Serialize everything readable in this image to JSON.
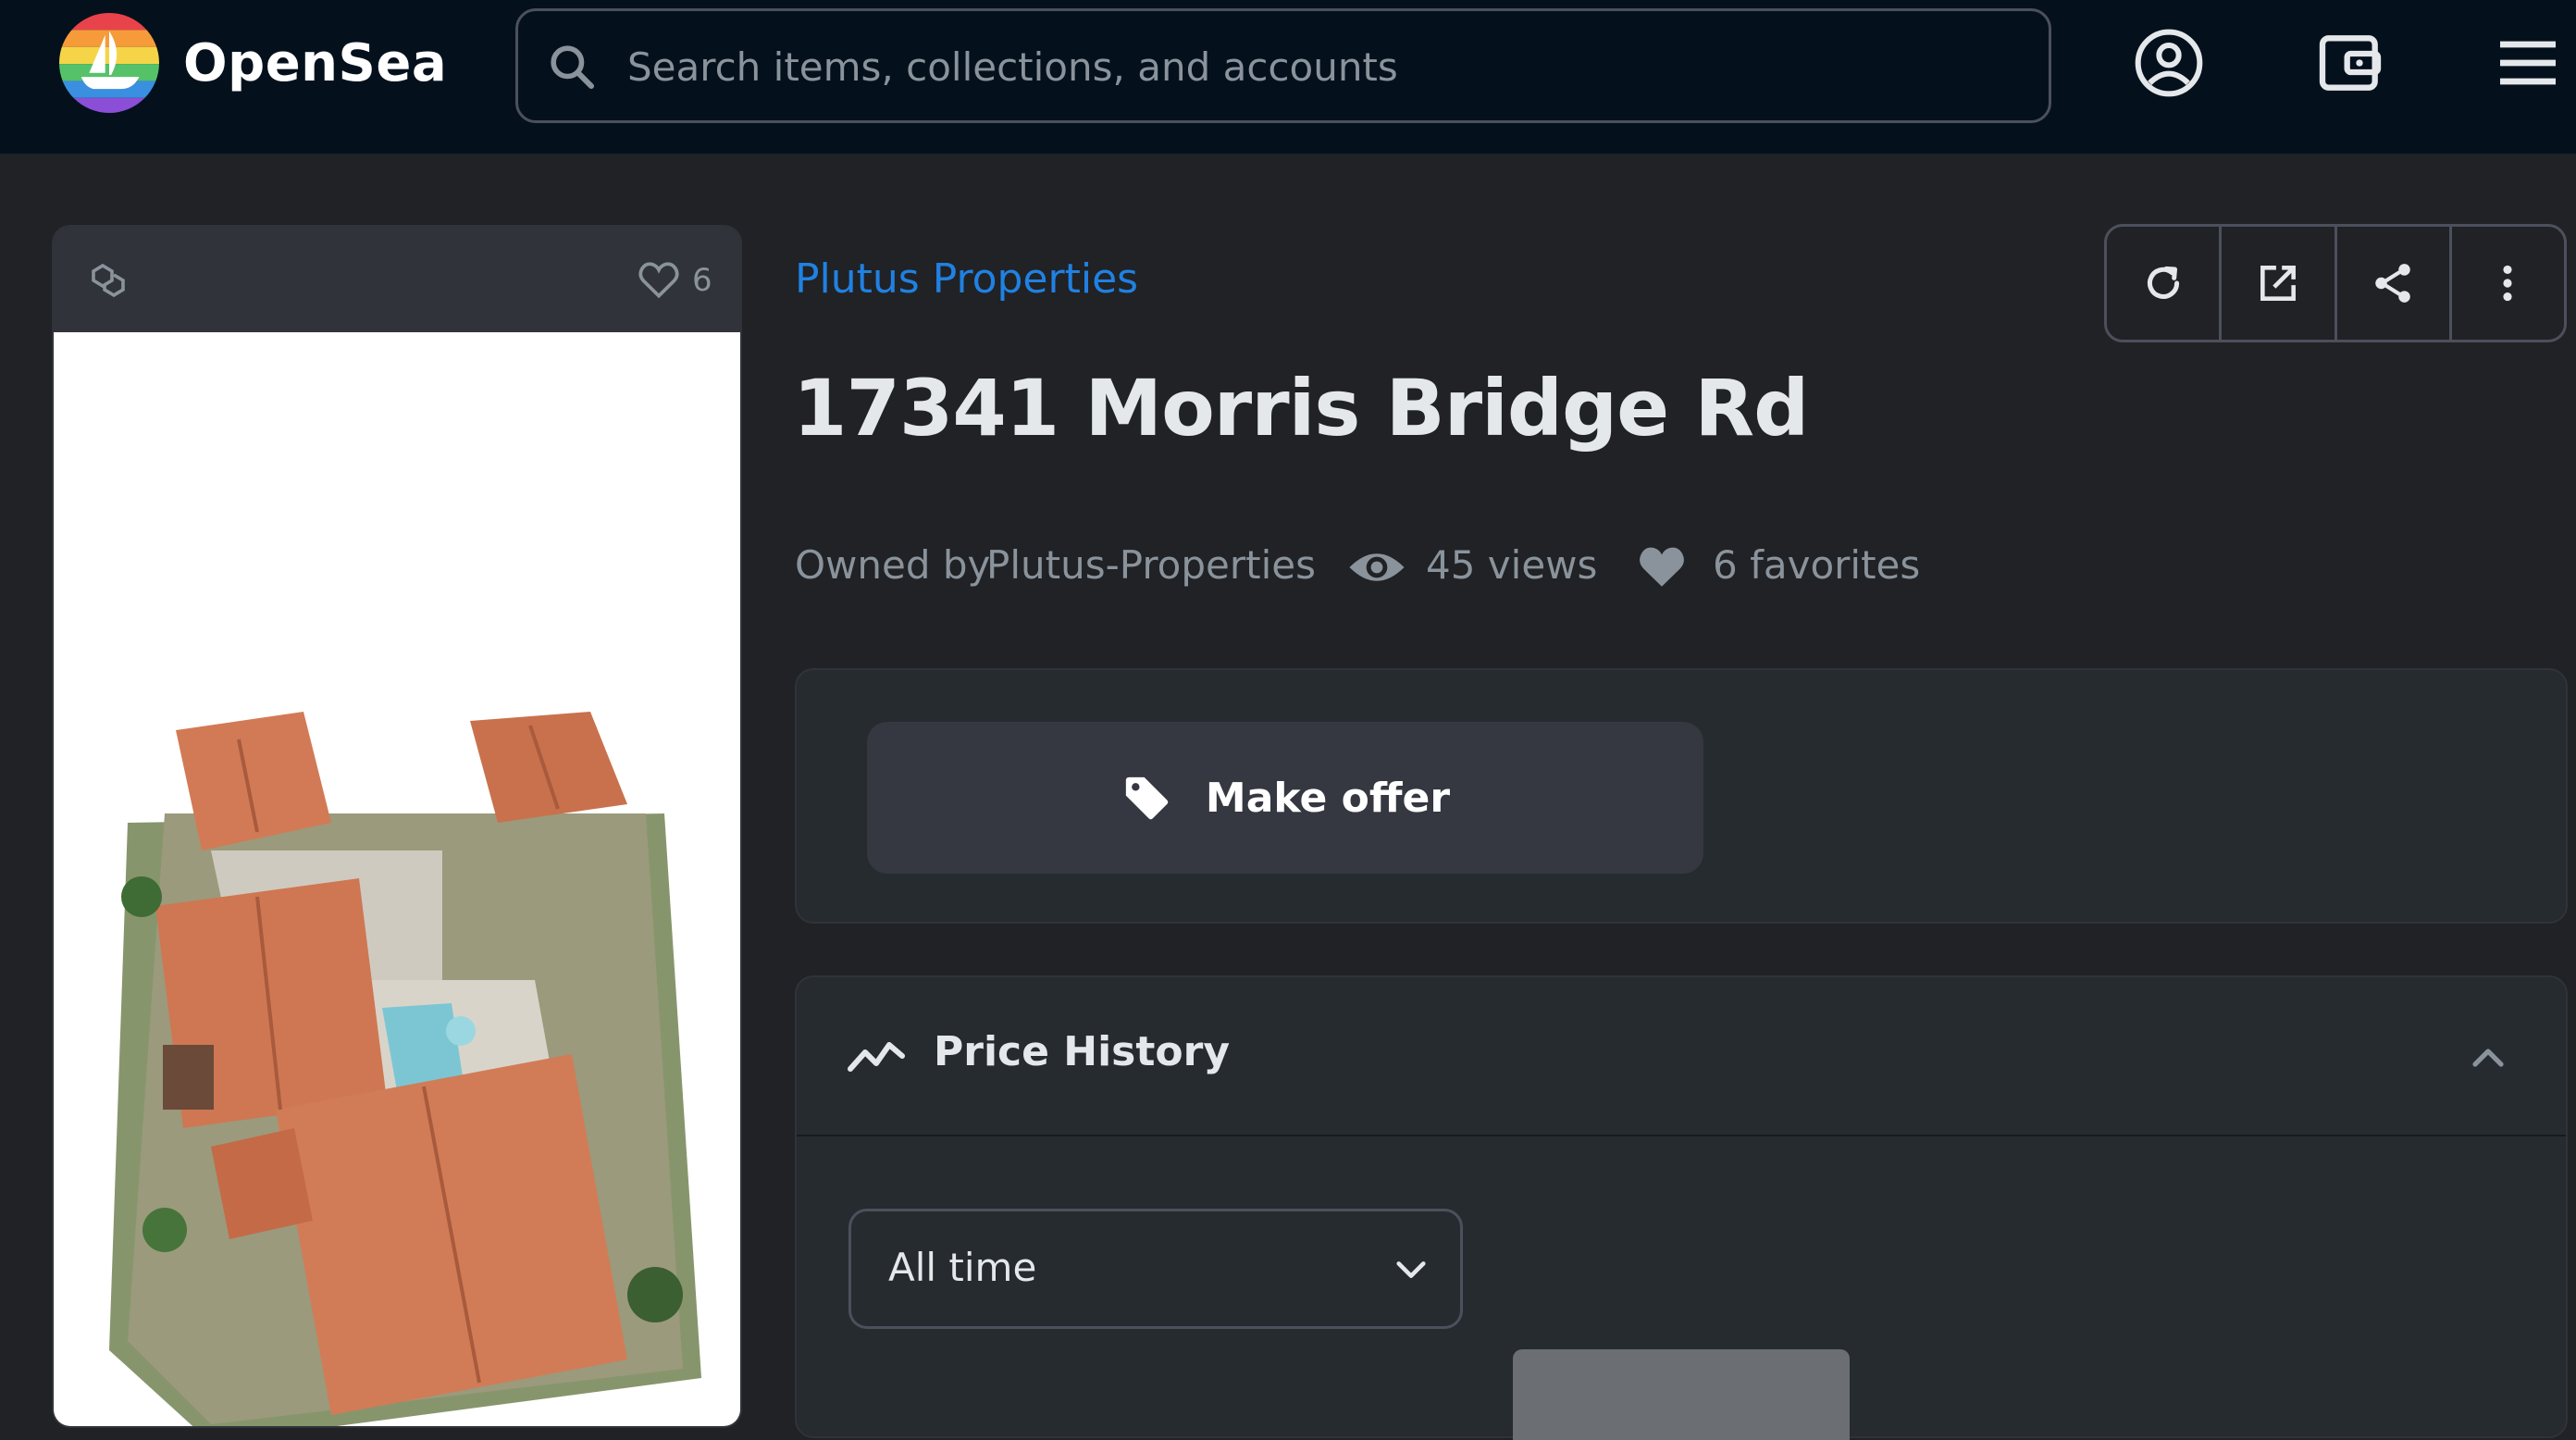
{
  "header": {
    "brand": "OpenSea",
    "search_placeholder": "Search items, collections, and accounts",
    "icons": [
      "account-icon",
      "wallet-icon",
      "menu-icon"
    ]
  },
  "card": {
    "chain_icon": "polygon-chain-icon",
    "favorite_count": "6"
  },
  "item": {
    "collection": "Plutus Properties",
    "title": "17341 Morris Bridge Rd",
    "owned_by_label": "Owned by",
    "owner": "Plutus-Properties",
    "views": "45 views",
    "favorites": "6 favorites"
  },
  "actions": [
    "refresh-icon",
    "external-link-icon",
    "share-icon",
    "more-icon"
  ],
  "offer": {
    "button_label": "Make offer"
  },
  "price_history": {
    "title": "Price History",
    "range_value": "All time"
  },
  "colors": {
    "header_bg": "#04111d",
    "page_bg": "#202225",
    "link": "#2081e2",
    "button_bg": "#353840"
  }
}
